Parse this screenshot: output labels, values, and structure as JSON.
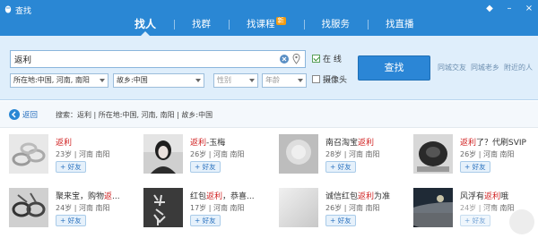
{
  "window": {
    "title": "查找"
  },
  "tabs": [
    {
      "label": "找人",
      "active": true
    },
    {
      "label": "找群"
    },
    {
      "label": "找课程",
      "badge": "新"
    },
    {
      "label": "找服务"
    },
    {
      "label": "找直播"
    }
  ],
  "search": {
    "value": "返利",
    "online_label": "在 线",
    "online_checked": true,
    "camera_label": "摄像头",
    "camera_checked": false,
    "location": "所在地:中国, 河南, 南阳",
    "hometown": "故乡:中国",
    "gender_placeholder": "性别",
    "age_placeholder": "年龄",
    "button": "查找",
    "quick_links": [
      "同城交友",
      "同城老乡",
      "附近的人"
    ]
  },
  "breadcrumb": {
    "back": "返回",
    "text": "搜索：返利 | 所在地:中国, 河南, 南阳 | 故乡:中国"
  },
  "results": [
    {
      "name_prefix": "",
      "name_hl": "返利",
      "name_suffix": "",
      "info": "23岁 | 河南 南阳",
      "add": "+ 好友",
      "avatar": "white-rings"
    },
    {
      "name_prefix": "",
      "name_hl": "返利",
      "name_suffix": "-玉梅",
      "info": "26岁 | 河南 南阳",
      "add": "+ 好友",
      "avatar": "girl-photo"
    },
    {
      "name_prefix": "南召淘宝",
      "name_hl": "返利",
      "name_suffix": "",
      "info": "28岁 | 河南 南阳",
      "add": "+ 好友",
      "avatar": "gray-blur"
    },
    {
      "name_prefix": "",
      "name_hl": "返利",
      "name_suffix": "了？代刷SVIP",
      "info": "26岁 | 河南 南阳",
      "add": "+ 好友",
      "avatar": "dark-object"
    },
    {
      "name_prefix": "聚来宝，购物",
      "name_hl": "返",
      "name_suffix": "...",
      "info": "24岁 | 河南 南阳",
      "add": "+ 好友",
      "avatar": "dark-rings"
    },
    {
      "name_prefix": "红包",
      "name_hl": "返利",
      "name_suffix": "，恭喜...",
      "info": "17岁 | 河南 南阳",
      "add": "+ 好友",
      "avatar": "calligraphy"
    },
    {
      "name_prefix": "诚信红包",
      "name_hl": "返利",
      "name_suffix": "为准",
      "info": "26岁 | 河南 南阳",
      "add": "+ 好友",
      "avatar": "gray-plain"
    },
    {
      "name_prefix": "风浮有",
      "name_hl": "返利",
      "name_suffix": "哦",
      "info": "24岁 | 河南 南阳",
      "add": "+ 好友",
      "avatar": "night-photo"
    }
  ],
  "colors": {
    "topbar": "#2a87d4",
    "panel": "#dfeefb",
    "button": "#2b86d6",
    "highlight": "#d02020"
  },
  "icons": [
    "qq-penguin-icon",
    "clear-icon",
    "location-pin-icon",
    "back-arrow-icon",
    "lock-icon",
    "minimize-icon",
    "close-icon"
  ]
}
